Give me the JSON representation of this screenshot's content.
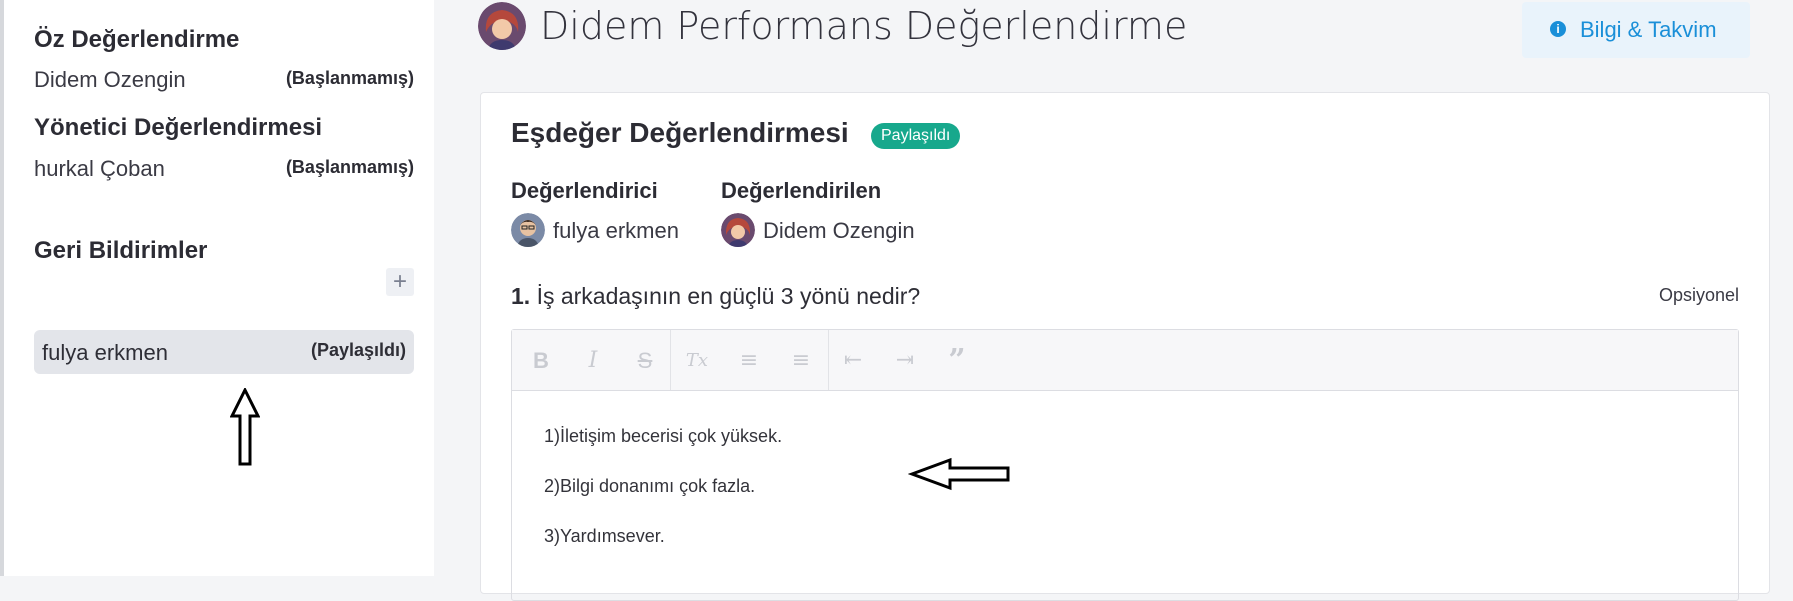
{
  "page": {
    "title": "Didem Performans Değerlendirme",
    "info_button": "Bilgi & Takvim",
    "info_icon": "info-icon"
  },
  "sidebar": {
    "self_review": {
      "heading": "Öz Değerlendirme",
      "name": "Didem Ozengin",
      "status": "(Başlanmamış)"
    },
    "manager_review": {
      "heading": "Yönetici Değerlendirmesi",
      "name": "hurkal Çoban",
      "status": "(Başlanmamış)"
    },
    "feedback": {
      "heading": "Geri Bildirimler",
      "add_label": "+",
      "items": [
        {
          "name": "fulya erkmen",
          "status": "(Paylaşıldı)"
        }
      ]
    }
  },
  "card": {
    "title": "Eşdeğer Değerlendirmesi",
    "badge": "Paylaşıldı",
    "reviewer_label": "Değerlendirici",
    "reviewer_name": "fulya erkmen",
    "reviewee_label": "Değerlendirilen",
    "reviewee_name": "Didem Ozengin",
    "question_number": "1.",
    "question_text": "İş arkadaşının en güçlü 3 yönü nedir?",
    "optional_label": "Opsiyonel",
    "toolbar": [
      {
        "name": "bold-icon",
        "glyph": "B"
      },
      {
        "name": "italic-icon",
        "glyph": "I"
      },
      {
        "name": "strikethrough-icon",
        "glyph": "S"
      },
      {
        "name": "clear-format-icon",
        "glyph": "Tx"
      },
      {
        "name": "ordered-list-icon",
        "glyph": "≡"
      },
      {
        "name": "bullet-list-icon",
        "glyph": "≡"
      },
      {
        "name": "outdent-icon",
        "glyph": "⇤"
      },
      {
        "name": "indent-icon",
        "glyph": "⇥"
      },
      {
        "name": "quote-icon",
        "glyph": "”"
      }
    ],
    "answer_lines": [
      "1)İletişim becerisi çok yüksek.",
      "2)Bilgi donanımı çok fazla.",
      "3)Yardımsever."
    ]
  },
  "colors": {
    "accent": "#1a8fd8",
    "badge": "#17a88c"
  }
}
